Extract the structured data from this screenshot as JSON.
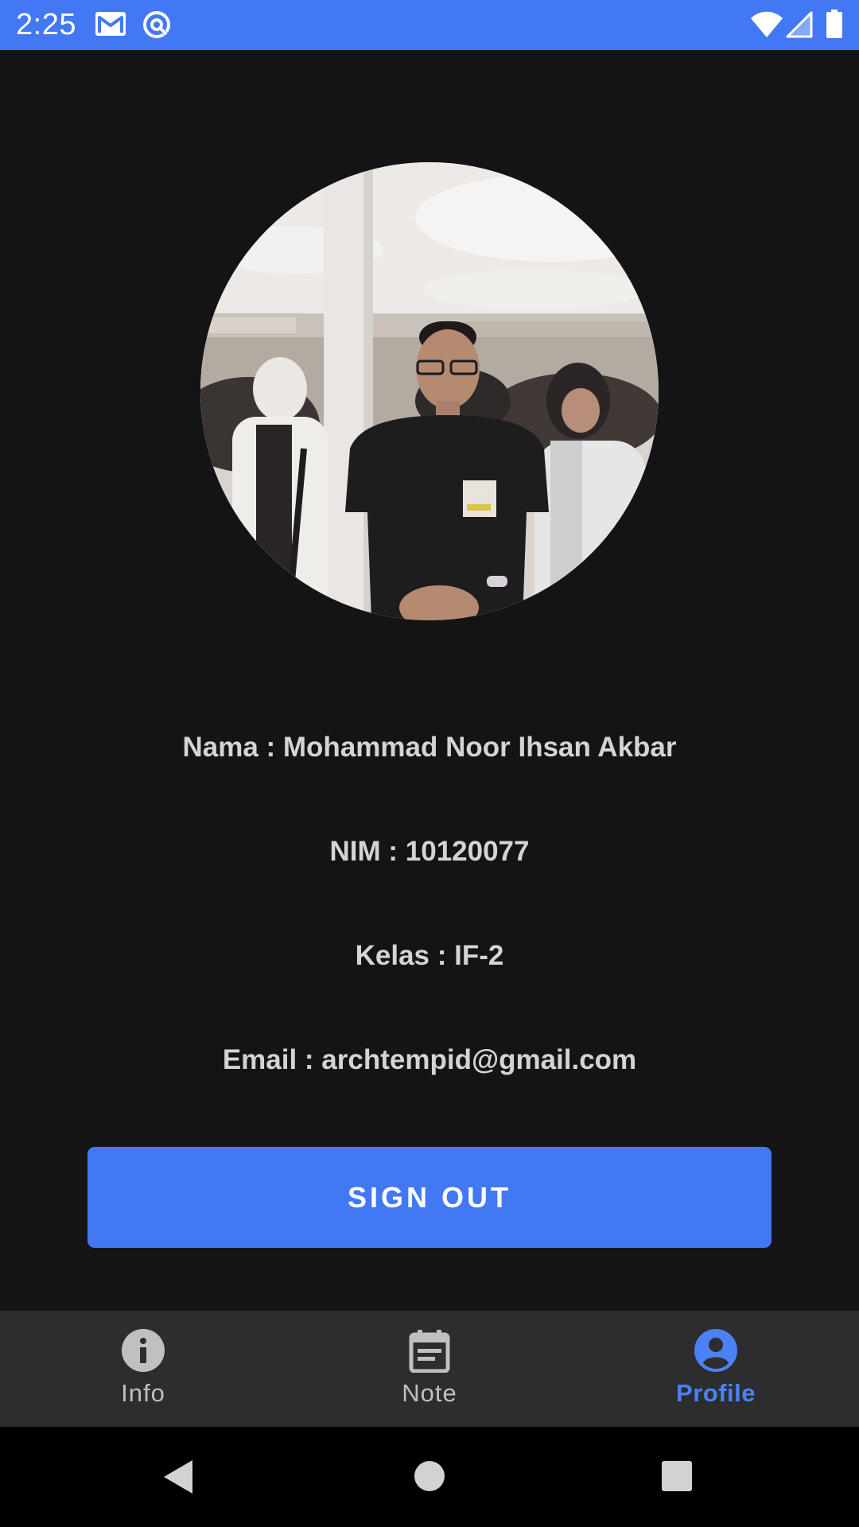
{
  "status_bar": {
    "time": "2:25",
    "background_color": "#4378f4",
    "left_icons": [
      "gmail-icon",
      "sync-icon"
    ],
    "right_icons": [
      "wifi-icon",
      "signal-icon",
      "battery-icon"
    ]
  },
  "profile": {
    "photo": "profile-photo",
    "name_line": "Nama : Mohammad Noor Ihsan Akbar",
    "nim_line": "NIM : 10120077",
    "kelas_line": "Kelas : IF-2",
    "email_line": "Email : archtempid@gmail.com"
  },
  "actions": {
    "signout_label": "SIGN OUT",
    "accent_color": "#4378f4"
  },
  "bottom_nav": {
    "items": [
      {
        "label": "Info",
        "icon": "info-icon",
        "active": false
      },
      {
        "label": "Note",
        "icon": "calendar-note-icon",
        "active": false
      },
      {
        "label": "Profile",
        "icon": "account-circle-icon",
        "active": true
      }
    ],
    "active_color": "#4a82f5"
  },
  "system_nav": {
    "buttons": [
      "back-icon",
      "home-icon",
      "recents-icon"
    ]
  }
}
